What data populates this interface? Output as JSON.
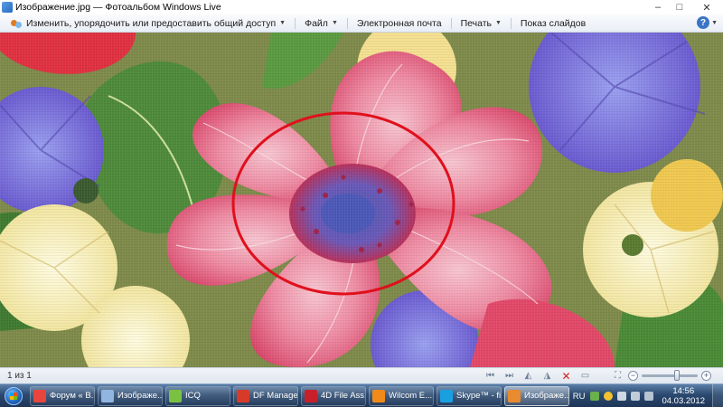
{
  "window": {
    "title": "Изображение.jpg — Фотоальбом Windows Live",
    "minimize": "–",
    "maximize": "□",
    "close": "✕"
  },
  "commandbar": {
    "share": "Изменить, упорядочить или предоставить общий доступ",
    "file": "Файл",
    "email": "Электронная почта",
    "print": "Печать",
    "slideshow": "Показ слайдов",
    "help": "?"
  },
  "image": {
    "subject": "floral fabric print with pink anemone",
    "annotation": "red circle around flower center"
  },
  "status": {
    "counter": "1 из 1",
    "zoom_level": 0.65
  },
  "taskbar": {
    "items": [
      {
        "label": "Форум « В...",
        "icon": "chrome-icon",
        "color": "#e8453c"
      },
      {
        "label": "Изображе...",
        "icon": "computer-icon",
        "color": "#8fb5e0"
      },
      {
        "label": "ICQ",
        "icon": "icq-icon",
        "color": "#7ac142"
      },
      {
        "label": "DF Manager",
        "icon": "df-manager-icon",
        "color": "#d83a2a"
      },
      {
        "label": "4D File Ass...",
        "icon": "4d-file-icon",
        "color": "#c8202a"
      },
      {
        "label": "Wilcom E...",
        "icon": "wilcom-icon",
        "color": "#f28a1a"
      },
      {
        "label": "Skype™ - fi...",
        "icon": "skype-icon",
        "color": "#1aa0e0"
      },
      {
        "label": "Изображе...",
        "icon": "photo-gallery-icon",
        "color": "#e88a30"
      }
    ],
    "language": "RU",
    "time": "14:56",
    "date": "04.03.2012"
  }
}
